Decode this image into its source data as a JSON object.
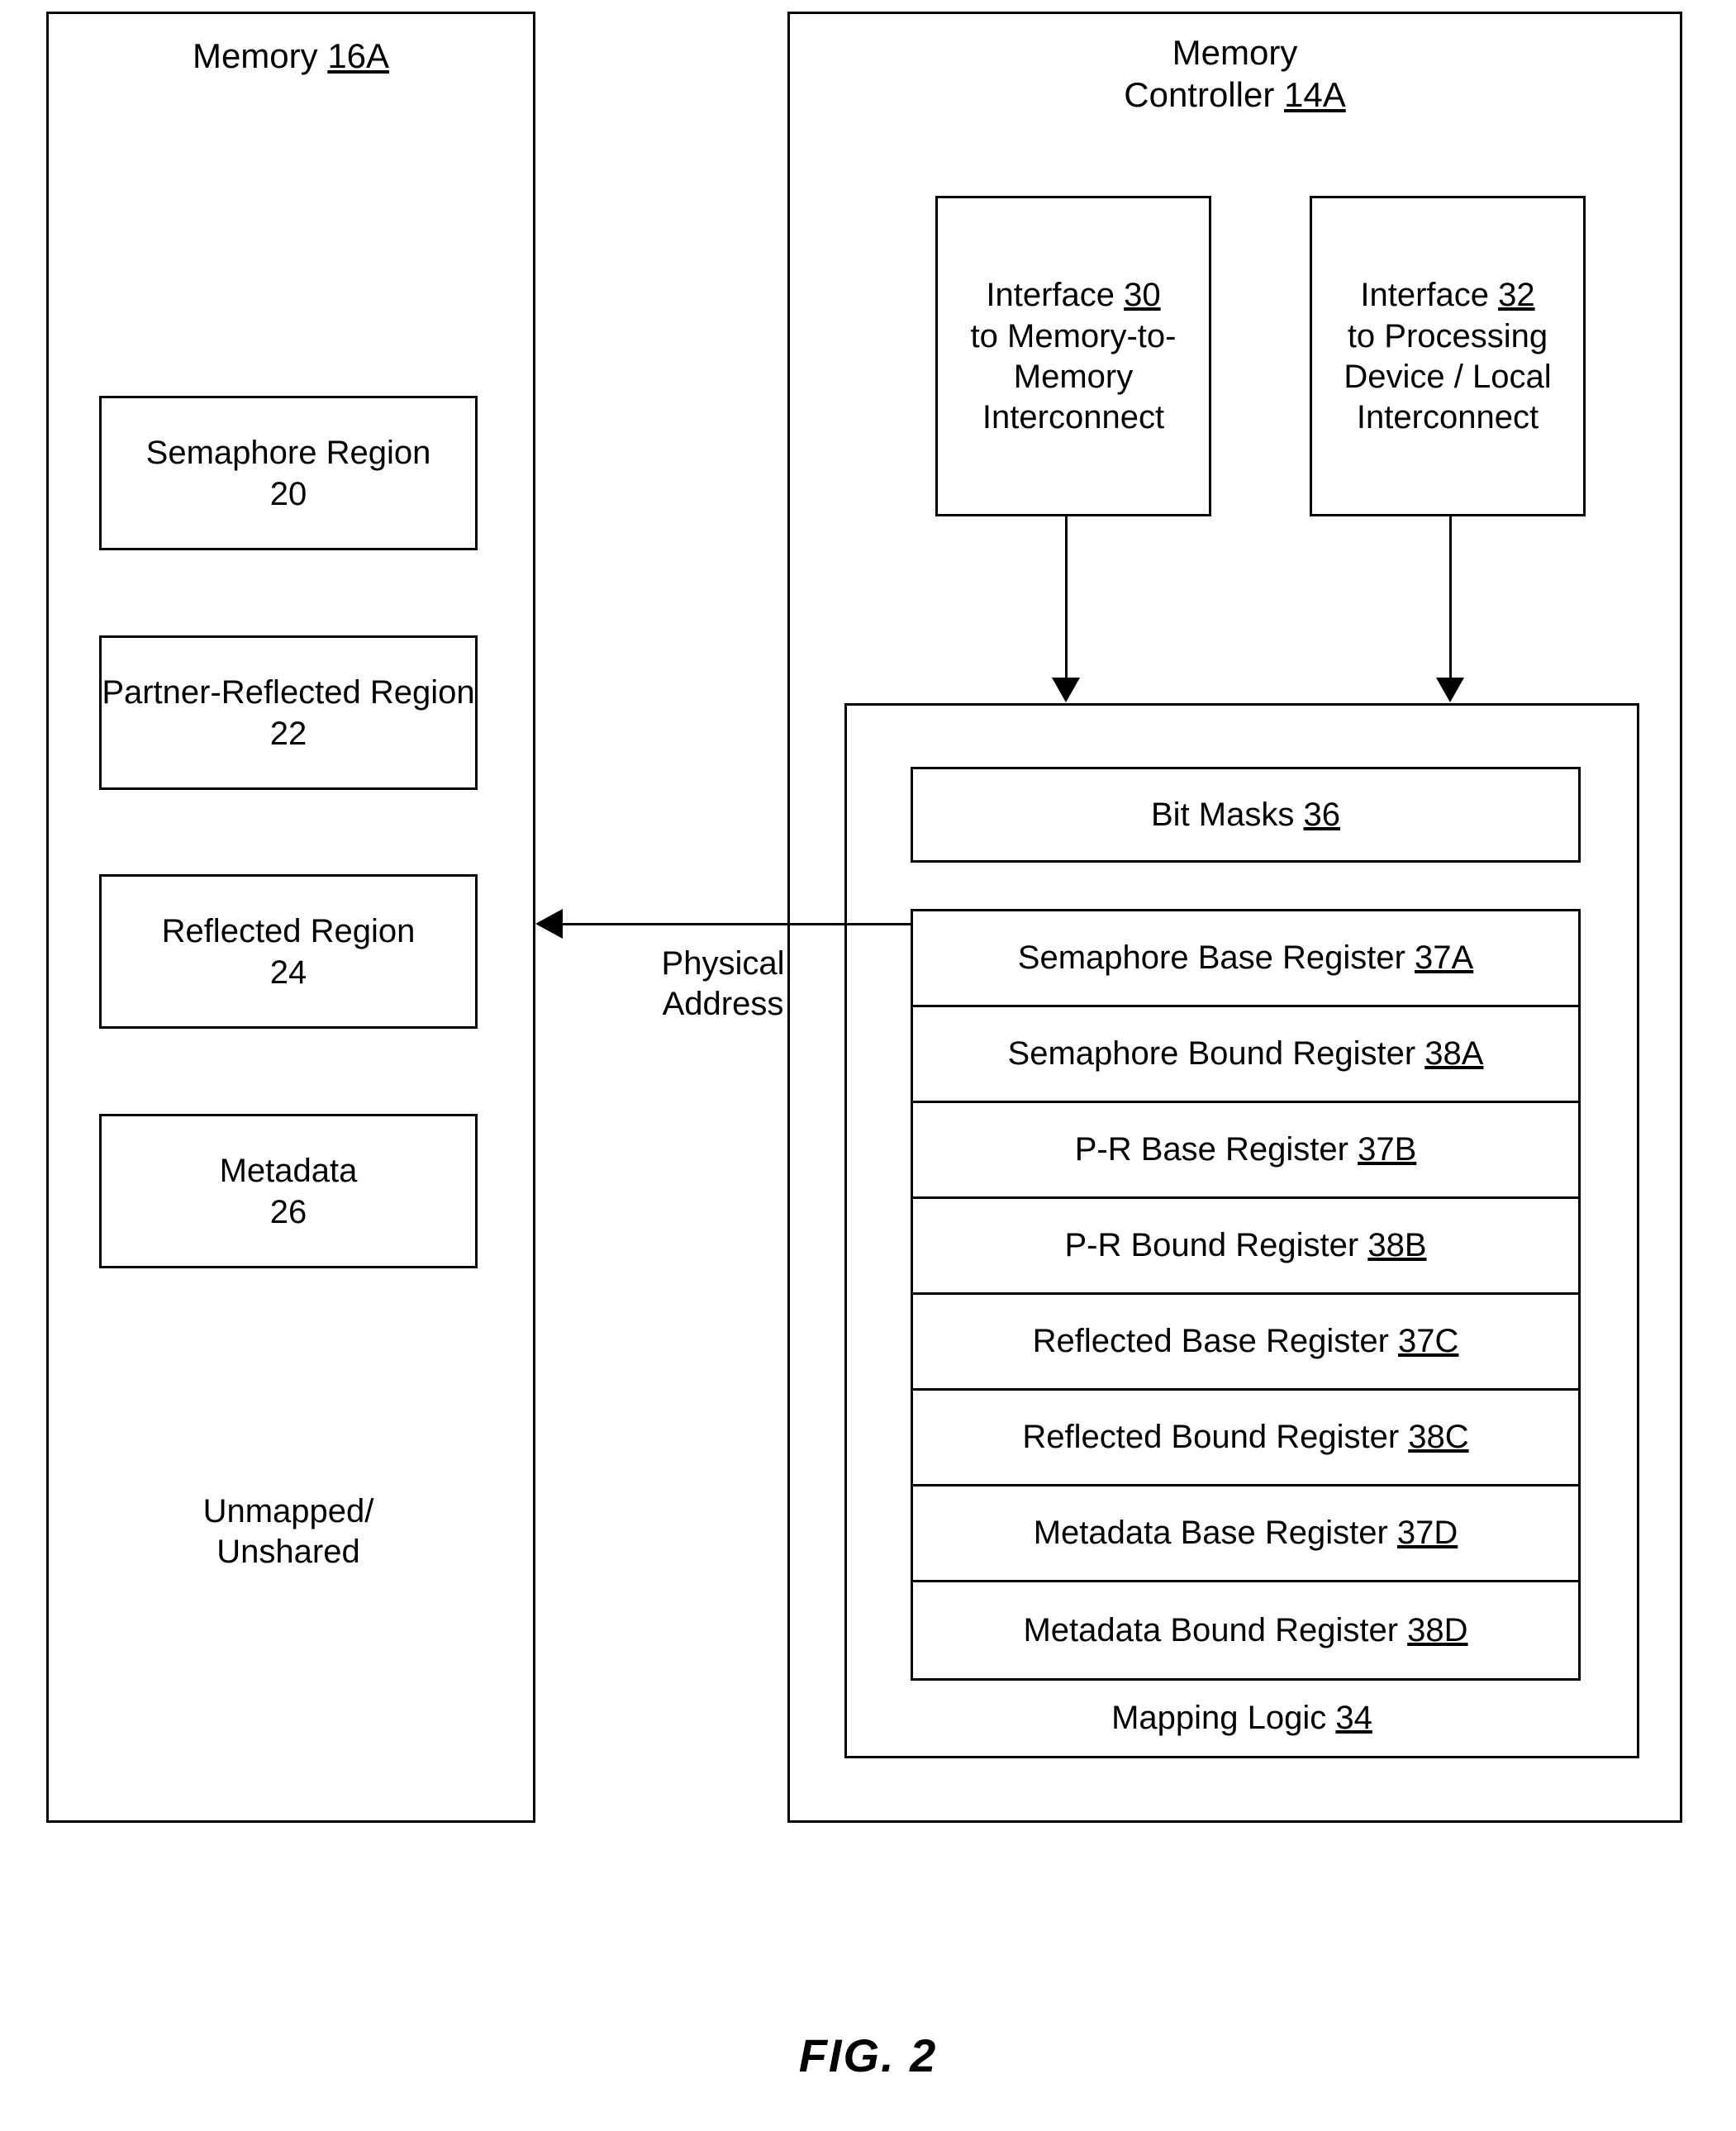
{
  "figure": {
    "caption": "FIG. 2"
  },
  "memory": {
    "title_text": "Memory ",
    "title_ref": "16A",
    "regions": [
      {
        "name": "Semaphore Region",
        "ref": "20"
      },
      {
        "name": "Partner-Reflected\nRegion",
        "ref": "22"
      },
      {
        "name": "Reflected Region",
        "ref": "24"
      },
      {
        "name": "Metadata",
        "ref": "26"
      }
    ],
    "unmapped_label": "Unmapped/\nUnshared"
  },
  "controller": {
    "title_line1": "Memory",
    "title_line2_text": "Controller ",
    "title_line2_ref": "14A",
    "interfaces": [
      {
        "head_text": "Interface ",
        "head_ref": "30",
        "body": "to Memory-to-\nMemory\nInterconnect"
      },
      {
        "head_text": "Interface ",
        "head_ref": "32",
        "body": "to Processing\nDevice / Local\nInterconnect"
      }
    ],
    "mapping_logic": {
      "label_text": "Mapping Logic ",
      "label_ref": "34",
      "bit_masks_text": "Bit Masks  ",
      "bit_masks_ref": "36",
      "registers": [
        {
          "name": "Semaphore Base Register ",
          "ref": "37A"
        },
        {
          "name": "Semaphore Bound Register ",
          "ref": "38A"
        },
        {
          "name": "P-R Base Register ",
          "ref": "37B"
        },
        {
          "name": "P-R Bound Register ",
          "ref": "38B"
        },
        {
          "name": "Reflected Base Register ",
          "ref": "37C"
        },
        {
          "name": "Reflected Bound Register ",
          "ref": "38C"
        },
        {
          "name": "Metadata Base Register ",
          "ref": "37D"
        },
        {
          "name": "Metadata Bound Register ",
          "ref": "38D"
        }
      ]
    }
  },
  "connections": {
    "physical_address_label": "Physical\nAddress"
  }
}
